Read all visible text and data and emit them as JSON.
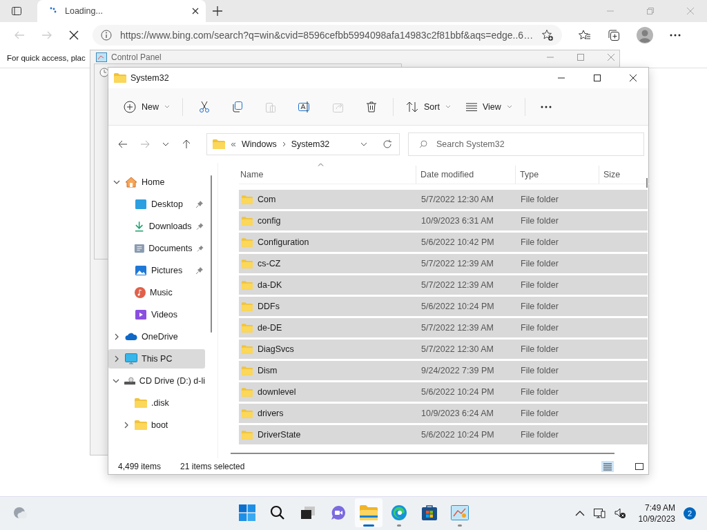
{
  "browser": {
    "tab": {
      "title": "Loading..."
    },
    "url": "https://www.bing.com/search?q=win&cvid=8596cefbb5994098afa14983c2f81bbf&aqs=edge..6…",
    "favorites_hint": "For quick access, plac"
  },
  "background_window": {
    "title": "Control Panel"
  },
  "explorer": {
    "title": "System32",
    "toolbar": {
      "new": "New",
      "sort": "Sort",
      "view": "View"
    },
    "breadcrumb": [
      "Windows",
      "System32"
    ],
    "search": {
      "placeholder": "Search System32"
    },
    "nav": [
      {
        "label": "Home",
        "kind": "home",
        "expanded": true,
        "selected": false,
        "children": [
          {
            "label": "Desktop",
            "kind": "desktop",
            "pinned": true,
            "selected": false
          },
          {
            "label": "Downloads",
            "kind": "downloads",
            "pinned": true,
            "selected": false
          },
          {
            "label": "Documents",
            "kind": "documents",
            "pinned": true,
            "selected": false
          },
          {
            "label": "Pictures",
            "kind": "pictures",
            "pinned": true,
            "selected": false
          },
          {
            "label": "Music",
            "kind": "music",
            "pinned": false,
            "selected": false
          },
          {
            "label": "Videos",
            "kind": "videos",
            "pinned": false,
            "selected": false
          }
        ]
      },
      {
        "label": "OneDrive",
        "kind": "cloud",
        "expanded": false,
        "selected": false
      },
      {
        "label": "This PC",
        "kind": "pc",
        "expanded": false,
        "selected": true
      },
      {
        "label": "CD Drive (D:) d-li",
        "kind": "drive",
        "expanded": true,
        "selected": false,
        "children": [
          {
            "label": ".disk",
            "kind": "folder",
            "selected": false
          },
          {
            "label": "boot",
            "kind": "folder",
            "expanded": false,
            "selected": false
          }
        ]
      }
    ],
    "columns": [
      {
        "label": "Name",
        "sorted": true
      },
      {
        "label": "Date modified",
        "sorted": false
      },
      {
        "label": "Type",
        "sorted": false
      },
      {
        "label": "Size",
        "sorted": false
      }
    ],
    "rows": [
      {
        "name": "Com",
        "date": "5/7/2022 12:30 AM",
        "type": "File folder",
        "selected": true
      },
      {
        "name": "config",
        "date": "10/9/2023 6:31 AM",
        "type": "File folder",
        "selected": true
      },
      {
        "name": "Configuration",
        "date": "5/6/2022 10:42 PM",
        "type": "File folder",
        "selected": true
      },
      {
        "name": "cs-CZ",
        "date": "5/7/2022 12:39 AM",
        "type": "File folder",
        "selected": true
      },
      {
        "name": "da-DK",
        "date": "5/7/2022 12:39 AM",
        "type": "File folder",
        "selected": true
      },
      {
        "name": "DDFs",
        "date": "5/6/2022 10:24 PM",
        "type": "File folder",
        "selected": true
      },
      {
        "name": "de-DE",
        "date": "5/7/2022 12:39 AM",
        "type": "File folder",
        "selected": true
      },
      {
        "name": "DiagSvcs",
        "date": "5/7/2022 12:30 AM",
        "type": "File folder",
        "selected": true
      },
      {
        "name": "Dism",
        "date": "9/24/2022 7:39 PM",
        "type": "File folder",
        "selected": true
      },
      {
        "name": "downlevel",
        "date": "5/6/2022 10:24 PM",
        "type": "File folder",
        "selected": true
      },
      {
        "name": "drivers",
        "date": "10/9/2023 6:24 AM",
        "type": "File folder",
        "selected": true
      },
      {
        "name": "DriverState",
        "date": "5/6/2022 10:24 PM",
        "type": "File folder",
        "selected": true
      }
    ],
    "status": {
      "count": "4,499 items",
      "selection": "21 items selected"
    },
    "views": [
      {
        "kind": "details",
        "selected": true
      },
      {
        "kind": "tiles",
        "selected": false
      }
    ]
  },
  "taskbar": {
    "apps": [
      {
        "kind": "start",
        "active": false,
        "running": false
      },
      {
        "kind": "search",
        "active": false,
        "running": false
      },
      {
        "kind": "taskview",
        "active": false,
        "running": false
      },
      {
        "kind": "chat",
        "active": false,
        "running": false
      },
      {
        "kind": "explorer",
        "active": true,
        "running": true
      },
      {
        "kind": "edge",
        "active": false,
        "running": true
      },
      {
        "kind": "store",
        "active": false,
        "running": false
      },
      {
        "kind": "controlpanel",
        "active": false,
        "running": true
      }
    ],
    "time": "7:49 AM",
    "date": "10/9/2023",
    "badge": "2"
  }
}
